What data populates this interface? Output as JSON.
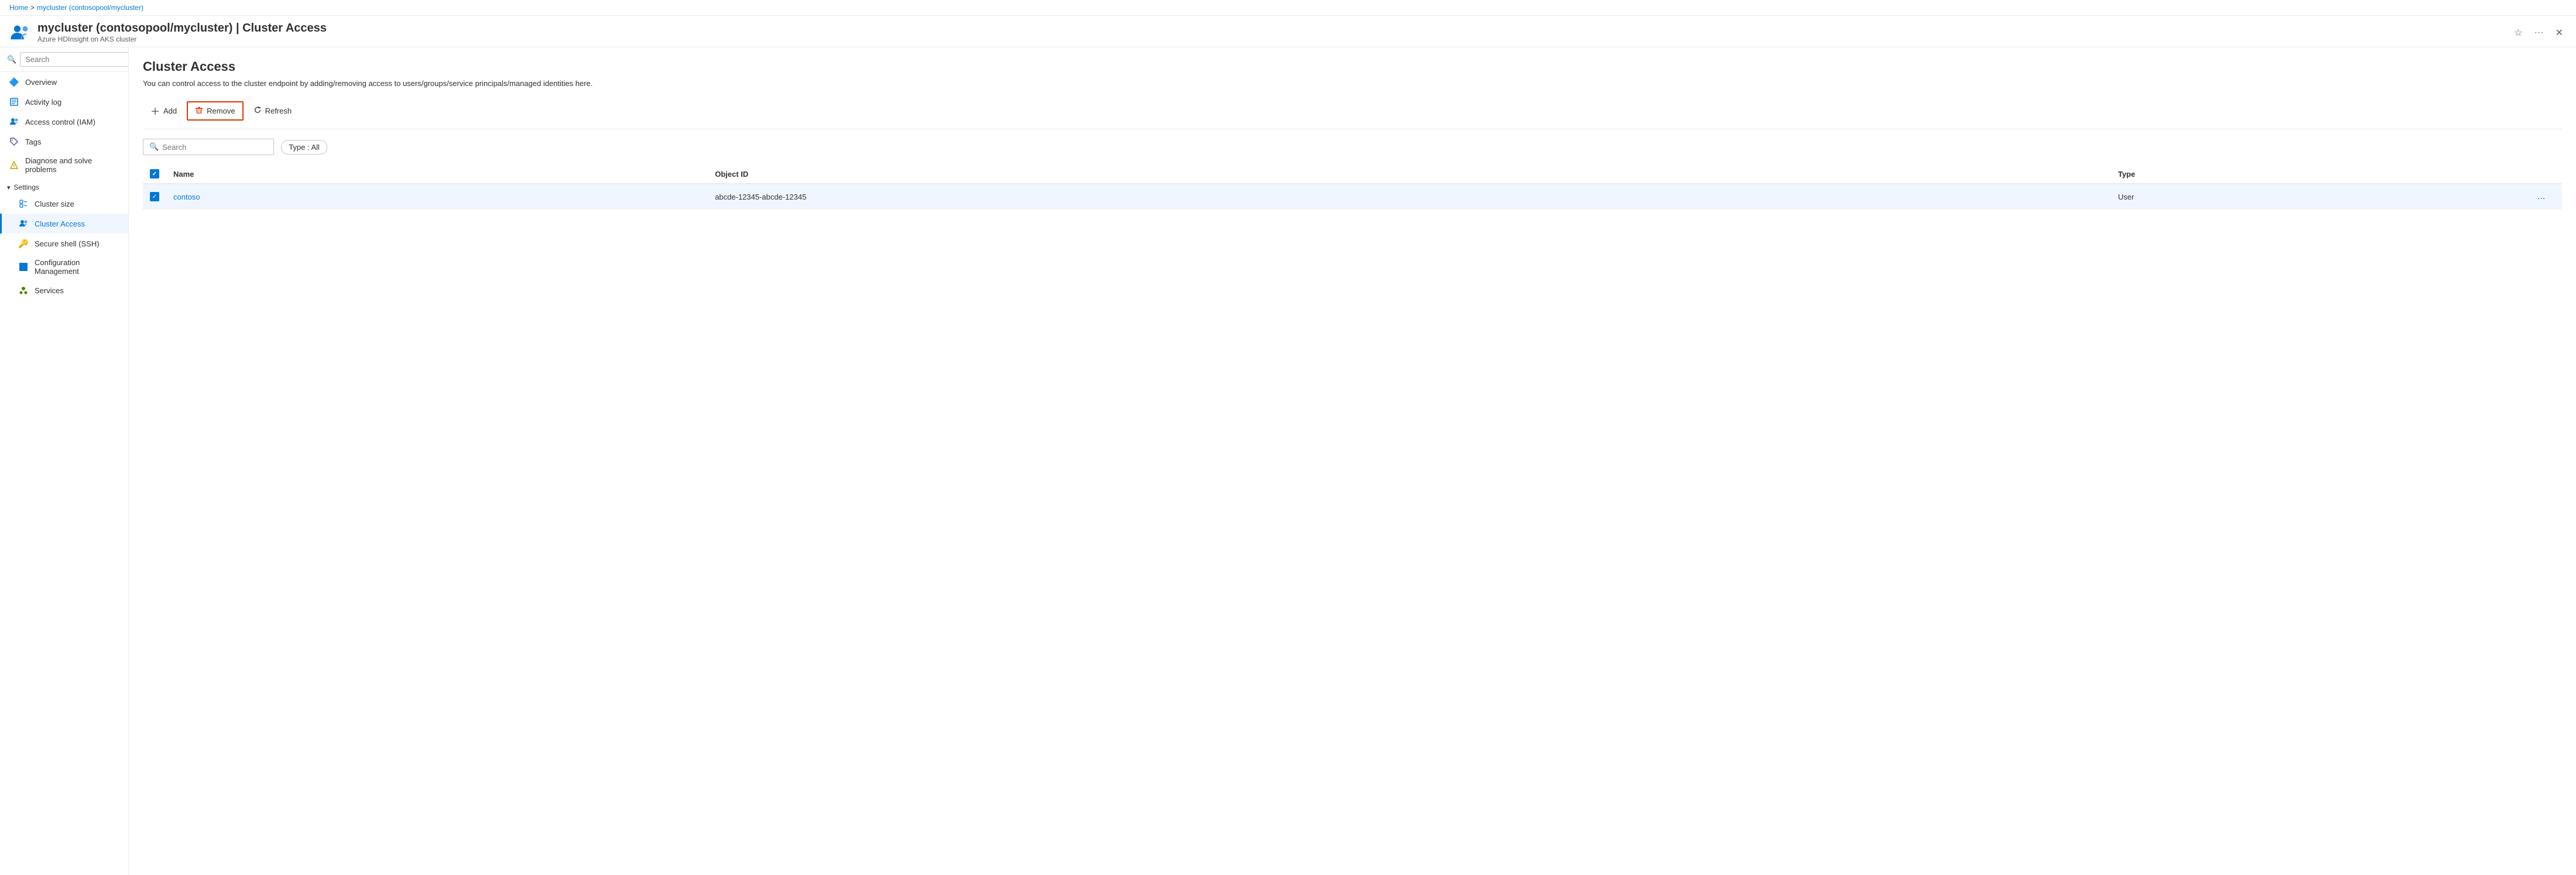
{
  "breadcrumb": {
    "home": "Home",
    "separator1": ">",
    "resource": "mycluster (contosopool/mycluster)"
  },
  "header": {
    "title": "mycluster (contosopool/mycluster) | Cluster Access",
    "subtitle": "Azure HDInsight on AKS cluster",
    "favorite_label": "Favorite",
    "more_label": "More",
    "close_label": "Close"
  },
  "sidebar": {
    "search_placeholder": "Search",
    "nav_items": [
      {
        "id": "overview",
        "label": "Overview",
        "icon": "🔷"
      },
      {
        "id": "activity-log",
        "label": "Activity log",
        "icon": "📋"
      },
      {
        "id": "access-control",
        "label": "Access control (IAM)",
        "icon": "👥"
      },
      {
        "id": "tags",
        "label": "Tags",
        "icon": "🏷️"
      },
      {
        "id": "diagnose",
        "label": "Diagnose and solve problems",
        "icon": "🔧"
      }
    ],
    "settings_section": "Settings",
    "settings_items": [
      {
        "id": "cluster-size",
        "label": "Cluster size",
        "icon": "📐"
      },
      {
        "id": "cluster-access",
        "label": "Cluster Access",
        "icon": "👥",
        "active": true
      },
      {
        "id": "secure-shell",
        "label": "Secure shell (SSH)",
        "icon": "🔑"
      },
      {
        "id": "config-management",
        "label": "Configuration Management",
        "icon": "⬛"
      },
      {
        "id": "services",
        "label": "Services",
        "icon": "👤"
      }
    ]
  },
  "content": {
    "title": "Cluster Access",
    "description": "You can control access to the cluster endpoint by adding/removing access to users/groups/service principals/managed identities here.",
    "toolbar": {
      "add_label": "Add",
      "remove_label": "Remove",
      "refresh_label": "Refresh"
    },
    "search_placeholder": "Search",
    "filter_label": "Type : All",
    "table": {
      "columns": [
        {
          "id": "checkbox",
          "label": ""
        },
        {
          "id": "name",
          "label": "Name"
        },
        {
          "id": "object-id",
          "label": "Object ID"
        },
        {
          "id": "type",
          "label": "Type"
        },
        {
          "id": "actions",
          "label": ""
        }
      ],
      "rows": [
        {
          "id": "row-1",
          "selected": true,
          "name": "contoso",
          "object_id": "abcde-12345-abcde-12345",
          "type": "User",
          "actions": "..."
        }
      ]
    }
  }
}
